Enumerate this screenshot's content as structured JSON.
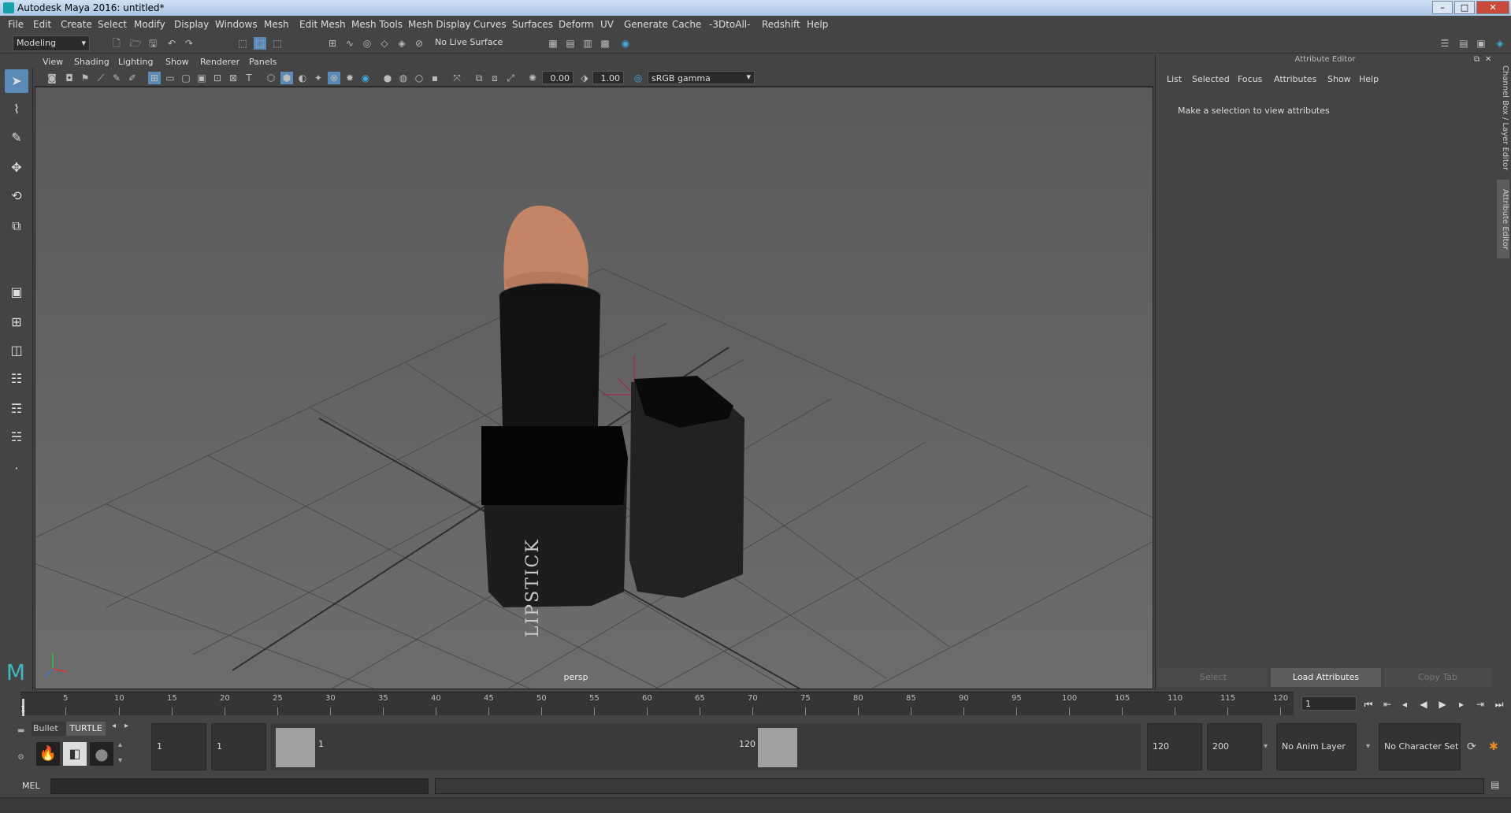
{
  "window": {
    "title": "Autodesk Maya 2016: untitled*",
    "minimize": "–",
    "maximize": "□",
    "close": "✕"
  },
  "menu": [
    "File",
    "Edit",
    "Create",
    "Select",
    "Modify",
    "Display",
    "Windows",
    "Mesh",
    "Edit Mesh",
    "Mesh Tools",
    "Mesh Display",
    "Curves",
    "Surfaces",
    "Deform",
    "UV",
    "Generate",
    "Cache",
    "-3DtoAll-",
    "Redshift",
    "Help"
  ],
  "shelf": {
    "mode": "Modeling",
    "live_surface": "No Live Surface"
  },
  "viewport_menu": [
    "View",
    "Shading",
    "Lighting",
    "Show",
    "Renderer",
    "Panels"
  ],
  "viewport_toolbar": {
    "gamma_value": "0.00",
    "exposure_value": "1.00",
    "color_space": "sRGB gamma"
  },
  "viewport": {
    "camera_label": "persp",
    "model_text": "LIPSTICK"
  },
  "attribute_editor": {
    "title": "Attribute Editor",
    "menu": [
      "List",
      "Selected",
      "Focus",
      "Attributes",
      "Show",
      "Help"
    ],
    "message": "Make a selection to view attributes",
    "buttons": {
      "select": "Select",
      "load": "Load Attributes",
      "copy": "Copy Tab"
    }
  },
  "side_tabs": {
    "channel_box": "Channel Box / Layer Editor",
    "attribute_editor": "Attribute Editor"
  },
  "timeline": {
    "labels": [
      "5",
      "10",
      "15",
      "20",
      "25",
      "30",
      "35",
      "40",
      "45",
      "50",
      "55",
      "60",
      "65",
      "70",
      "75",
      "80",
      "85",
      "90",
      "95",
      "100",
      "105",
      "110",
      "115",
      "120"
    ],
    "start_marker": "1",
    "current_frame": "1"
  },
  "shelf_tabs": {
    "bullet": "Bullet",
    "turtle": "TURTLE"
  },
  "range": {
    "start_frame": "1",
    "playback_start": "1",
    "slider_start": "1",
    "slider_end": "120",
    "playback_end": "120",
    "end_frame": "200",
    "anim_layer": "No Anim Layer",
    "character_set": "No Character Set"
  },
  "command_line": {
    "label": "MEL"
  },
  "colors": {
    "accent": "#5a8ab5",
    "background": "#444444",
    "viewport": "#636363",
    "lipstick": "#c48466",
    "case": "#1c1c1c"
  }
}
